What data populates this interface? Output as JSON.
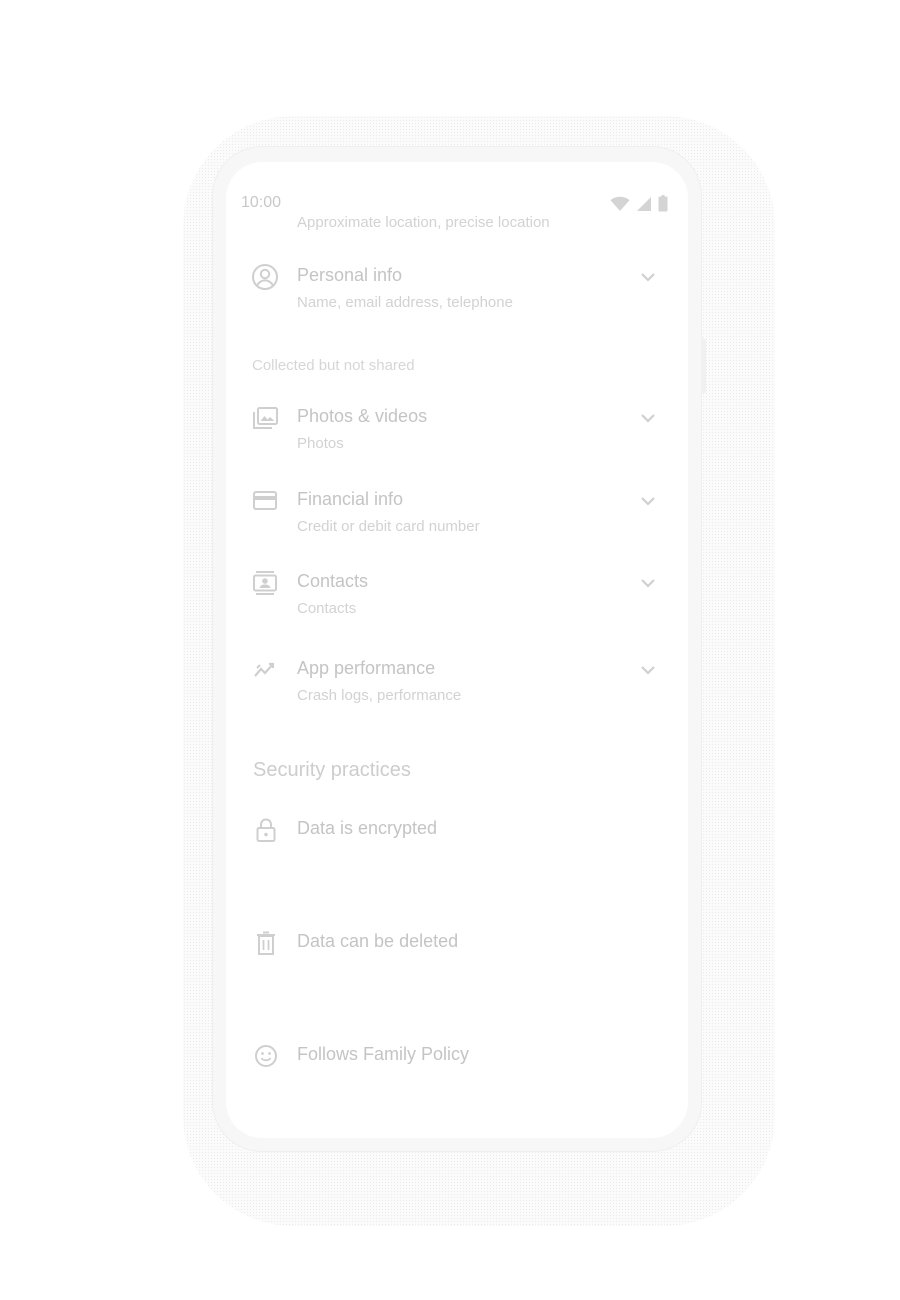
{
  "status_bar": {
    "time": "10:00",
    "icons": [
      "wifi-icon",
      "cellular-signal-icon",
      "battery-icon"
    ]
  },
  "data_safety": {
    "partial_row_subtitle": "Approximate location, precise location",
    "shared_items": [
      {
        "icon": "account-circle-icon",
        "title": "Personal info",
        "subtitle": "Name, email address, telephone"
      }
    ],
    "collected_label": "Collected but not shared",
    "collected_items": [
      {
        "icon": "photo-library-icon",
        "title": "Photos & videos",
        "subtitle": "Photos"
      },
      {
        "icon": "credit-card-icon",
        "title": "Financial info",
        "subtitle": "Credit or debit card number"
      },
      {
        "icon": "contacts-icon",
        "title": "Contacts",
        "subtitle": "Contacts"
      },
      {
        "icon": "performance-icon",
        "title": "App performance",
        "subtitle": "Crash logs, performance"
      }
    ],
    "security_heading": "Security practices",
    "security_items": [
      {
        "icon": "lock-icon",
        "title": "Data is encrypted"
      },
      {
        "icon": "delete-icon",
        "title": "Data can be deleted"
      },
      {
        "icon": "smiley-face-icon",
        "title": "Follows Family Policy"
      }
    ]
  },
  "colors": {
    "text_faded": "#c4c4c4",
    "subtext_faded": "#d2d2d2",
    "frame": "#f7f7f7",
    "screen": "#ffffff"
  }
}
